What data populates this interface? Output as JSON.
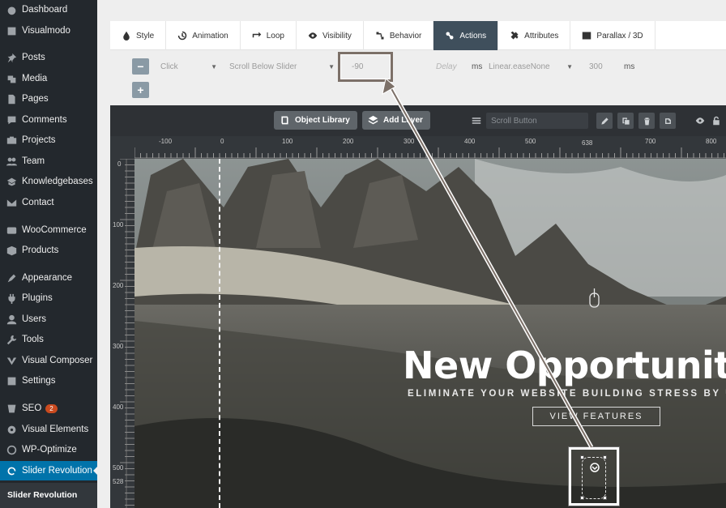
{
  "sidebar": {
    "items": [
      {
        "label": "Dashboard",
        "icon": "dashboard-icon"
      },
      {
        "label": "Visualmodo",
        "icon": "visualmodo-icon"
      },
      {
        "label": "Posts",
        "icon": "pin-icon"
      },
      {
        "label": "Media",
        "icon": "media-icon"
      },
      {
        "label": "Pages",
        "icon": "page-icon"
      },
      {
        "label": "Comments",
        "icon": "comment-icon"
      },
      {
        "label": "Projects",
        "icon": "projects-icon"
      },
      {
        "label": "Team",
        "icon": "team-icon"
      },
      {
        "label": "Knowledgebases",
        "icon": "knowledge-icon"
      },
      {
        "label": "Contact",
        "icon": "mail-icon"
      },
      {
        "label": "WooCommerce",
        "icon": "woo-icon"
      },
      {
        "label": "Products",
        "icon": "products-icon"
      },
      {
        "label": "Appearance",
        "icon": "appearance-icon"
      },
      {
        "label": "Plugins",
        "icon": "plugin-icon"
      },
      {
        "label": "Users",
        "icon": "user-icon"
      },
      {
        "label": "Tools",
        "icon": "wrench-icon"
      },
      {
        "label": "Visual Composer",
        "icon": "composer-icon"
      },
      {
        "label": "Settings",
        "icon": "settings-icon"
      },
      {
        "label": "SEO",
        "icon": "seo-icon",
        "badge": "2"
      },
      {
        "label": "Visual Elements",
        "icon": "gear-icon"
      },
      {
        "label": "WP-Optimize",
        "icon": "optimize-icon"
      },
      {
        "label": "Slider Revolution",
        "icon": "refresh-icon",
        "active": true
      }
    ],
    "footer": "Slider Revolution"
  },
  "tabs": [
    {
      "label": "Style",
      "icon": "drop-icon"
    },
    {
      "label": "Animation",
      "icon": "history-icon"
    },
    {
      "label": "Loop",
      "icon": "loop-icon"
    },
    {
      "label": "Visibility",
      "icon": "eye-icon"
    },
    {
      "label": "Behavior",
      "icon": "behavior-icon"
    },
    {
      "label": "Actions",
      "icon": "link-icon",
      "active": true
    },
    {
      "label": "Attributes",
      "icon": "tools-icon"
    },
    {
      "label": "Parallax / 3D",
      "icon": "image-icon"
    }
  ],
  "actions": {
    "remove_btn": "−",
    "add_btn": "+",
    "trigger": "Click",
    "action": "Scroll Below Slider",
    "offset": "-90",
    "delay_label": "Delay",
    "delay_unit": "ms",
    "easing": "Linear.easeNone",
    "speed": "300",
    "speed_unit": "ms"
  },
  "editor": {
    "object_library": "Object Library",
    "add_layer": "Add Layer",
    "layer_name": "Scroll Button"
  },
  "ruler": {
    "h": [
      "-100",
      "0",
      "100",
      "200",
      "300",
      "400",
      "500",
      "638",
      "700",
      "800"
    ],
    "v": [
      "0",
      "100",
      "200",
      "300",
      "400",
      "500",
      "528"
    ]
  },
  "slide": {
    "title": "New Opportunit",
    "subtitle": "ELIMINATE YOUR WEBSITE BUILDING STRESS BY USING",
    "button": "VIEW FEATURES"
  },
  "colors": {
    "sidebar_bg": "#23282d",
    "active_menu": "#0073aa",
    "active_tab": "#3f4f5c",
    "editor_bar": "#2e3135"
  }
}
